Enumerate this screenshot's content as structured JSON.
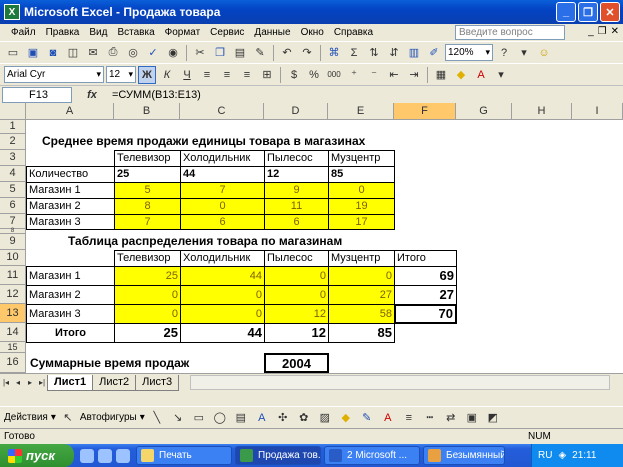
{
  "window": {
    "title": "Microsoft Excel - Продажа товара",
    "app_icon": "X"
  },
  "menu": [
    "Файл",
    "Правка",
    "Вид",
    "Вставка",
    "Формат",
    "Сервис",
    "Данные",
    "Окно",
    "Справка"
  ],
  "help_placeholder": "Введите вопрос",
  "toolbar": {
    "zoom": "120%",
    "font": "Arial Cyr",
    "size": "12",
    "bold": "Ж",
    "italic": "К",
    "underline": "Ч",
    "percent": "%",
    "thousands": "000"
  },
  "formula_bar": {
    "name_box": "F13",
    "fx": "fx",
    "formula": "=СУММ(B13:E13)"
  },
  "columns": [
    "A",
    "B",
    "C",
    "D",
    "E",
    "F",
    "G",
    "H",
    "I"
  ],
  "rows": [
    "1",
    "2",
    "3",
    "4",
    "5",
    "6",
    "7",
    "8",
    "9",
    "10",
    "11",
    "12",
    "13",
    "14",
    "15",
    "16"
  ],
  "sheet": {
    "title1": "Среднее время продажи единицы товара в магазинах",
    "headers1": [
      "Телевизор",
      "Холодильник",
      "Пылесос",
      "Музцентр"
    ],
    "qty_label": "Количество",
    "qty": [
      "25",
      "44",
      "12",
      "85"
    ],
    "stores": [
      "Магазин 1",
      "Магазин 2",
      "Магазин 3"
    ],
    "times": [
      [
        "5",
        "7",
        "9",
        "0"
      ],
      [
        "8",
        "0",
        "11",
        "19"
      ],
      [
        "7",
        "6",
        "6",
        "17"
      ]
    ],
    "title2": "Таблица распределения товара по магазинам",
    "headers2": [
      "Телевизор",
      "Холодильник",
      "Пылесос",
      "Музцентр",
      "Итого"
    ],
    "dist": [
      [
        "25",
        "44",
        "0",
        "0",
        "69"
      ],
      [
        "0",
        "0",
        "0",
        "27",
        "27"
      ],
      [
        "0",
        "0",
        "12",
        "58",
        "70"
      ]
    ],
    "total_label": "Итого",
    "totals": [
      "25",
      "44",
      "12",
      "85"
    ],
    "sum_label": "Суммарные время продаж",
    "sum_value": "2004"
  },
  "sheet_tabs": [
    "Лист1",
    "Лист2",
    "Лист3"
  ],
  "drawing": {
    "actions": "Действия",
    "autoshapes": "Автофигуры"
  },
  "status": {
    "ready": "Готово",
    "num": "NUM"
  },
  "taskbar": {
    "start": "пуск",
    "tasks": [
      "Печать",
      "Продажа тов...",
      "2 Microsoft ...",
      "Безымянный - ..."
    ],
    "lang": "RU",
    "time": "21:11"
  }
}
